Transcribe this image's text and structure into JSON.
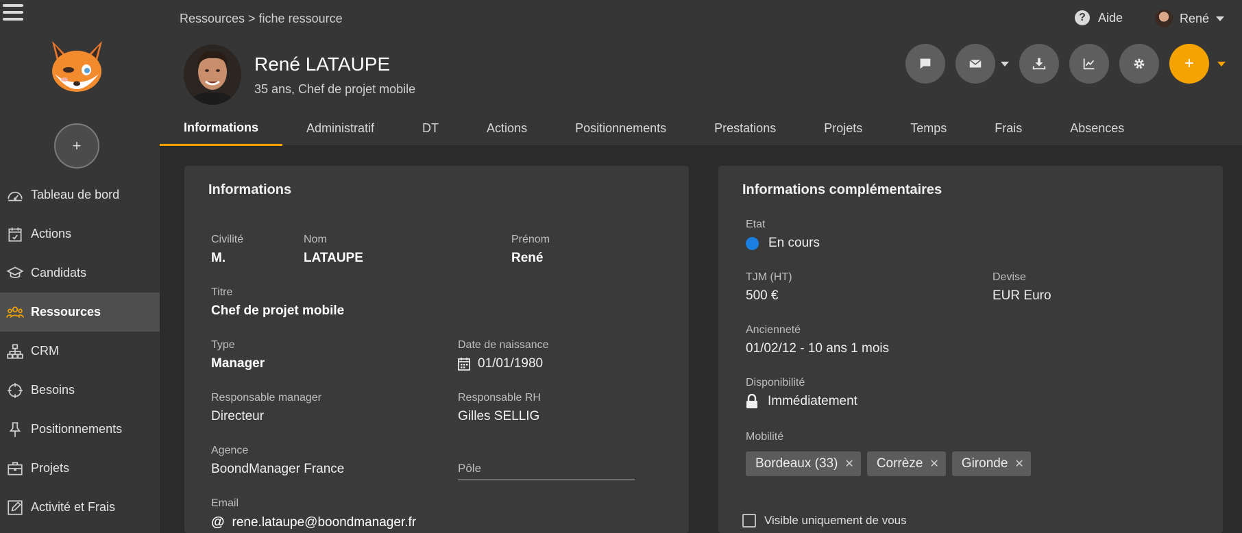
{
  "header": {
    "breadcrumb": "Ressources > fiche ressource",
    "help_label": "Aide",
    "user_name": "René"
  },
  "profile": {
    "name": "René LATAUPE",
    "subtitle": "35 ans, Chef de projet mobile"
  },
  "sidebar": {
    "add_label": "+",
    "items": [
      {
        "label": "Tableau de bord",
        "icon": "dashboard-icon"
      },
      {
        "label": "Actions",
        "icon": "calendar-check-icon"
      },
      {
        "label": "Candidats",
        "icon": "graduation-cap-icon"
      },
      {
        "label": "Ressources",
        "icon": "people-icon"
      },
      {
        "label": "CRM",
        "icon": "sitemap-icon"
      },
      {
        "label": "Besoins",
        "icon": "crosshair-icon"
      },
      {
        "label": "Positionnements",
        "icon": "pin-icon"
      },
      {
        "label": "Projets",
        "icon": "briefcase-icon"
      },
      {
        "label": "Activité et Frais",
        "icon": "edit-icon"
      }
    ]
  },
  "actions": {
    "add_label": "+"
  },
  "tabs": [
    {
      "label": "Informations"
    },
    {
      "label": "Administratif"
    },
    {
      "label": "DT"
    },
    {
      "label": "Actions"
    },
    {
      "label": "Positionnements"
    },
    {
      "label": "Prestations"
    },
    {
      "label": "Projets"
    },
    {
      "label": "Temps"
    },
    {
      "label": "Frais"
    },
    {
      "label": "Absences"
    }
  ],
  "info": {
    "title": "Informations",
    "civilite_label": "Civilité",
    "civilite": "M.",
    "nom_label": "Nom",
    "nom": "LATAUPE",
    "prenom_label": "Prénom",
    "prenom": "René",
    "titre_label": "Titre",
    "titre": "Chef de projet mobile",
    "type_label": "Type",
    "type": "Manager",
    "naissance_label": "Date de naissance",
    "naissance": "01/01/1980",
    "resp_manager_label": "Responsable manager",
    "resp_manager": "Directeur",
    "resp_rh_label": "Responsable RH",
    "resp_rh": "Gilles SELLIG",
    "agence_label": "Agence",
    "agence": "BoondManager France",
    "pole_placeholder": "Pôle",
    "email_label": "Email",
    "email": "rene.lataupe@boondmanager.fr"
  },
  "complement": {
    "title": "Informations complémentaires",
    "etat_label": "Etat",
    "etat": "En cours",
    "tjm_label": "TJM (HT)",
    "tjm": "500 €",
    "devise_label": "Devise",
    "devise": "EUR Euro",
    "anciennete_label": "Ancienneté",
    "anciennete": "01/02/12 - 10 ans 1 mois",
    "dispo_label": "Disponibilité",
    "dispo": "Immédiatement",
    "mobilite_label": "Mobilité",
    "mobilite": [
      "Bordeaux (33)",
      "Corrèze",
      "Gironde"
    ],
    "visible_label": "Visible uniquement de vous"
  },
  "colors": {
    "accent": "#f5a300",
    "status_blue": "#1a7fe0",
    "panel": "#3a3a3a",
    "sidebar": "#363636"
  }
}
